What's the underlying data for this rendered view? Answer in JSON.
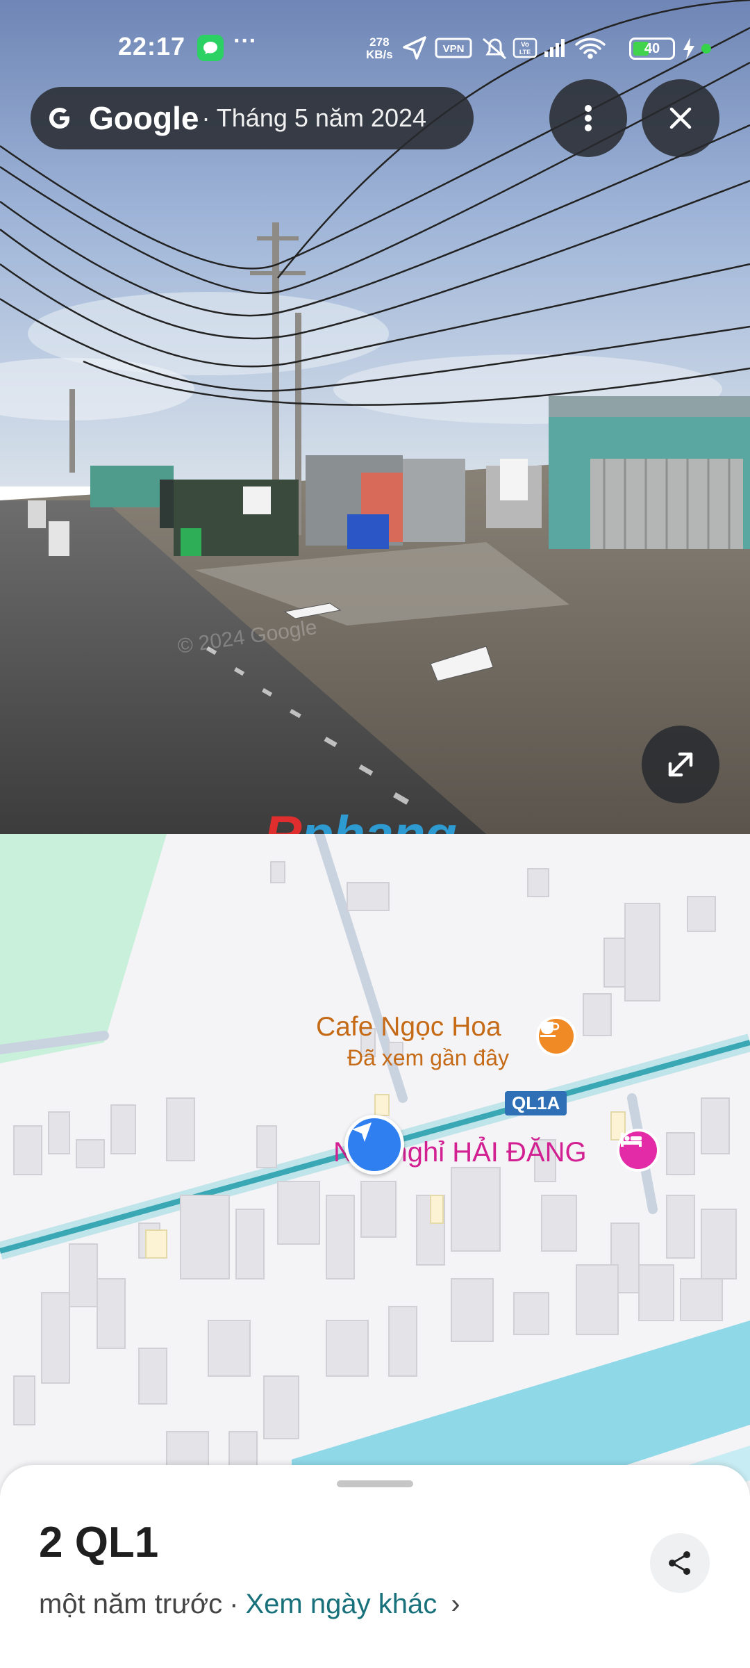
{
  "status_bar": {
    "time": "22:17",
    "more": "···",
    "speed_value": "278",
    "speed_unit": "KB/s",
    "vpn_label": "VPN",
    "volte_label": "Vo LTE",
    "battery_level": "40",
    "icons": [
      "message-icon",
      "location-arrow-icon",
      "vpn-icon",
      "mute-bell-icon",
      "volte-icon",
      "signal-icon",
      "wifi-icon",
      "battery-icon",
      "charging-icon"
    ]
  },
  "street_view": {
    "brand": "Google",
    "date": "· Tháng 5 năm 2024",
    "copyright": "© 2024 Google",
    "menu_icon": "more-vert-icon",
    "close_icon": "close-icon",
    "expand_icon": "expand-icon"
  },
  "watermark": {
    "first": "R",
    "rest": "phang"
  },
  "map": {
    "poi_cafe": {
      "name": "Cafe Ngọc Hoa",
      "subtitle": "Đã xem gần đây",
      "icon": "coffee-icon",
      "color": "#f08a24"
    },
    "route_shield": "QL1A",
    "poi_hotel": {
      "name": "Nhà nghỉ HẢI ĐĂNG",
      "icon": "bed-icon",
      "color": "#e32aa7"
    },
    "location_icon": "navigation-arrow-icon"
  },
  "sheet": {
    "title": "2 QL1",
    "time_ago": "một năm trước",
    "separator": "·",
    "other_dates": "Xem ngày khác",
    "chevron": "›",
    "share_icon": "share-icon"
  },
  "colors": {
    "accent_link": "#17707a",
    "location_blue": "#2f7ff0",
    "road_highway": "#3aa7b5"
  }
}
